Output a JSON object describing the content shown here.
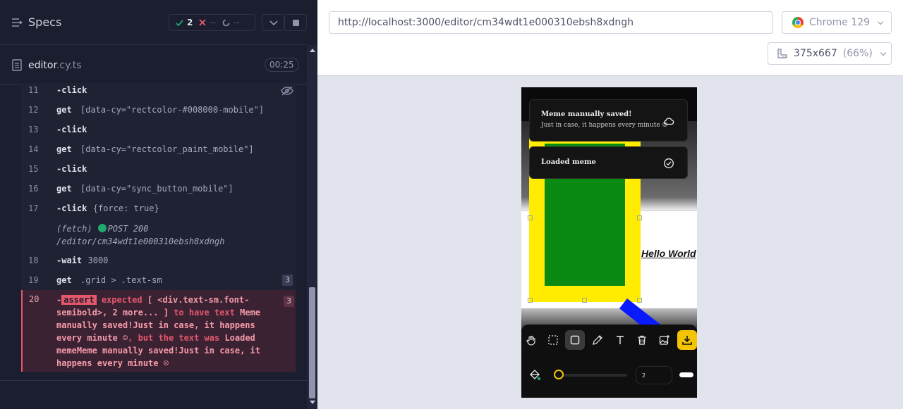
{
  "reporter": {
    "title": "Specs",
    "stats": {
      "passed": "2",
      "failed": "--",
      "pending": "--"
    },
    "spec": {
      "name": "editor",
      "ext": ".cy.ts",
      "duration": "00:25"
    },
    "commands": [
      {
        "n": "11",
        "name": "-click",
        "arg": "",
        "badge": ""
      },
      {
        "n": "12",
        "name": "get",
        "arg": "[data-cy=\"rectcolor-#008000-mobile\"]",
        "badge": ""
      },
      {
        "n": "13",
        "name": "-click",
        "arg": "",
        "badge": ""
      },
      {
        "n": "14",
        "name": "get",
        "arg": "[data-cy=\"rectcolor_paint_mobile\"]",
        "badge": ""
      },
      {
        "n": "15",
        "name": "-click",
        "arg": "",
        "badge": ""
      },
      {
        "n": "16",
        "name": "get",
        "arg": "[data-cy=\"sync_button_mobile\"]",
        "badge": ""
      },
      {
        "n": "17",
        "name": "-click",
        "arg": "{force: true}",
        "badge": ""
      },
      {
        "n": "18",
        "name": "-wait",
        "arg": "3000",
        "badge": ""
      },
      {
        "n": "19",
        "name": "get",
        "arg": ".grid > .text-sm",
        "badge": "3"
      }
    ],
    "fetch": {
      "label": "(fetch)",
      "method": "POST 200",
      "path": "/editor/cm34wdt1e000310ebsh8xdngh"
    },
    "assertion": {
      "n": "20",
      "dash": "-",
      "keyword": "assert",
      "expected_label": "expected",
      "subject": "[ <div.text-sm.font-semibold>, 2 more... ]",
      "to_have_text": "to have text",
      "expected_text": "Meme manually saved!Just in case, it happens every minute ☺",
      "but_text": ", but the text was",
      "actual_text": "Loaded memeMeme manually saved!Just in case, it happens every minute ☺",
      "badge": "3"
    }
  },
  "app": {
    "url": "http://localhost:3000/editor/cm34wdt1e000310ebsh8xdngh",
    "browser": "Chrome 129",
    "viewport": "375x667",
    "zoom": "(66%)"
  },
  "aut": {
    "canvas_text": "Hello World",
    "toasts": [
      {
        "title": "Meme manually saved!",
        "desc": "Just in case, it happens every minute ☺"
      },
      {
        "title": "Loaded meme",
        "desc": ""
      }
    ],
    "stroke_width": "2",
    "colors": {
      "yellow": "#ffec00",
      "green": "#0a8a13",
      "blue": "#0a1aff",
      "accent": "#f5c400"
    }
  }
}
